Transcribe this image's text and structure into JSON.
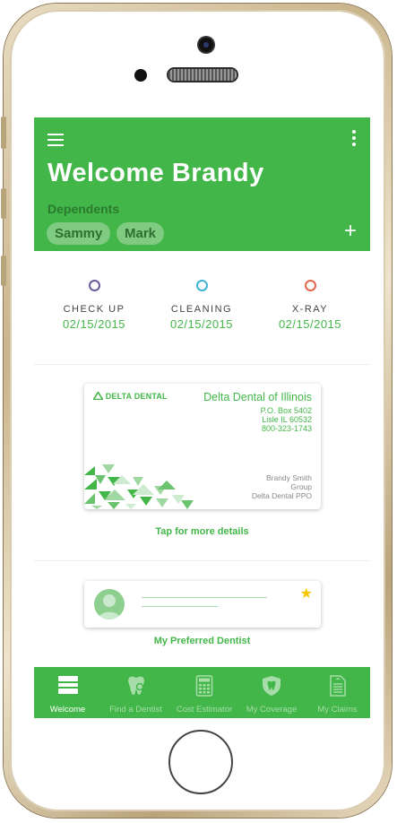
{
  "header": {
    "welcome": "Welcome Brandy",
    "dependents_label": "Dependents",
    "dependents": [
      "Sammy",
      "Mark"
    ],
    "add": "+"
  },
  "appointments": [
    {
      "label": "CHECK UP",
      "date": "02/15/2015",
      "color": "#6b5b9a"
    },
    {
      "label": "CLEANING",
      "date": "02/15/2015",
      "color": "#3fb3d5"
    },
    {
      "label": "X-RAY",
      "date": "02/15/2015",
      "color": "#e3674f"
    }
  ],
  "id_card": {
    "brand": "DELTA DENTAL",
    "org": "Delta Dental of Illinois",
    "address": [
      "P.O. Box 5402",
      "Lisle IL 60532",
      "800-323-1743"
    ],
    "member": [
      "Brandy Smith",
      "Group",
      "Delta Dental PPO"
    ],
    "tap_text": "Tap for more details"
  },
  "preferred_dentist": {
    "label": "My Preferred Dentist"
  },
  "tabs": [
    {
      "label": "Welcome",
      "icon": "welcome-icon",
      "active": true
    },
    {
      "label": "Find a Dentist",
      "icon": "tooth-search-icon",
      "active": false
    },
    {
      "label": "Cost Estimator",
      "icon": "calculator-icon",
      "active": false
    },
    {
      "label": "My Coverage",
      "icon": "shield-tooth-icon",
      "active": false
    },
    {
      "label": "My Claims",
      "icon": "document-icon",
      "active": false
    }
  ],
  "colors": {
    "brand_green": "#43b649",
    "chip": "#7ecb81",
    "star": "#f6c500"
  }
}
